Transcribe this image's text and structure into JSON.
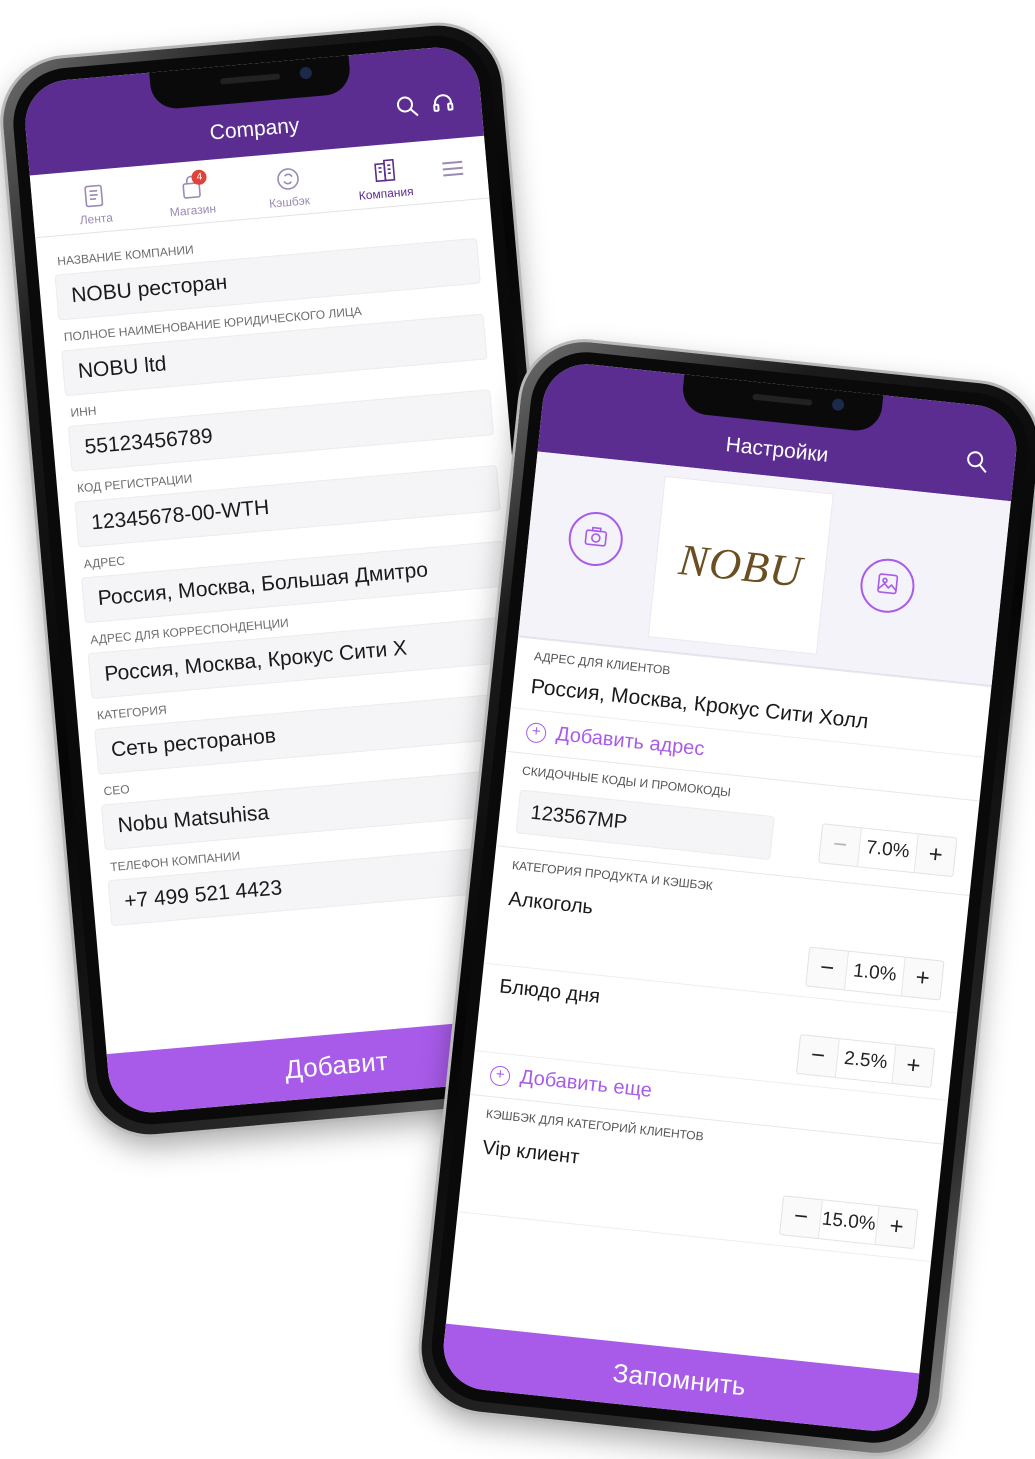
{
  "phone1": {
    "header": {
      "title": "Company"
    },
    "tabs": [
      {
        "label": "Лента",
        "icon": "newspaper-icon"
      },
      {
        "label": "Магазин",
        "icon": "shopping-bag-icon",
        "badge": "4"
      },
      {
        "label": "Кэшбэк",
        "icon": "cashback-icon"
      },
      {
        "label": "Компания",
        "icon": "building-icon",
        "active": true
      }
    ],
    "fields": [
      {
        "label": "НАЗВАНИЕ КОМПАНИИ",
        "value": "NOBU ресторан"
      },
      {
        "label": "ПОЛНОЕ НАИМЕНОВАНИЕ ЮРИДИЧЕСКОГО ЛИЦА",
        "value": "NOBU ltd"
      },
      {
        "label": "ИНН",
        "value": "55123456789"
      },
      {
        "label": "КОД РЕГИСТРАЦИИ",
        "value": "12345678-00-WTH"
      },
      {
        "label": "АДРЕС",
        "value": "Россия, Москва, Большая Дмитро"
      },
      {
        "label": "АДРЕС ДЛЯ КОРРЕСПОНДЕНЦИИ",
        "value": "Россия, Москва, Крокус Сити Х"
      },
      {
        "label": "КАТЕГОРИЯ",
        "value": "Сеть ресторанов"
      },
      {
        "label": "CEO",
        "value": "Nobu Matsuhisa"
      },
      {
        "label": "ТЕЛЕФОН КОМПАНИИ",
        "value": "+7 499 521 4423"
      }
    ],
    "bottom_button": "Добавит"
  },
  "phone2": {
    "header": {
      "title": "Настройки"
    },
    "logo_text": "NOBU",
    "client_address": {
      "label": "АДРЕС ДЛЯ КЛИЕНТОВ",
      "value": "Россия, Москва, Крокус Сити Холл",
      "add": "Добавить адрес"
    },
    "promo": {
      "label": "СКИДОЧНЫЕ КОДЫ И ПРОМОКОДЫ",
      "code": "123567MP",
      "value": "7.0%"
    },
    "categories": {
      "label": "КАТЕГОРИЯ ПРОДУКТА И КЭШБЭК",
      "items": [
        {
          "name": "Алкоголь",
          "value": "1.0%"
        },
        {
          "name": "Блюдо дня",
          "value": "2.5%"
        }
      ],
      "add": "Добавить еще"
    },
    "client_cashback": {
      "label": "КЭШБЭК ДЛЯ КАТЕГОРИЙ КЛИЕНТОВ",
      "items": [
        {
          "name": "Vip клиент",
          "value": "15.0%"
        }
      ]
    },
    "bottom_button": "Запомнить"
  },
  "colors": {
    "header": "#5b2d91",
    "accent": "#a85be9",
    "badge": "#e0433b"
  }
}
